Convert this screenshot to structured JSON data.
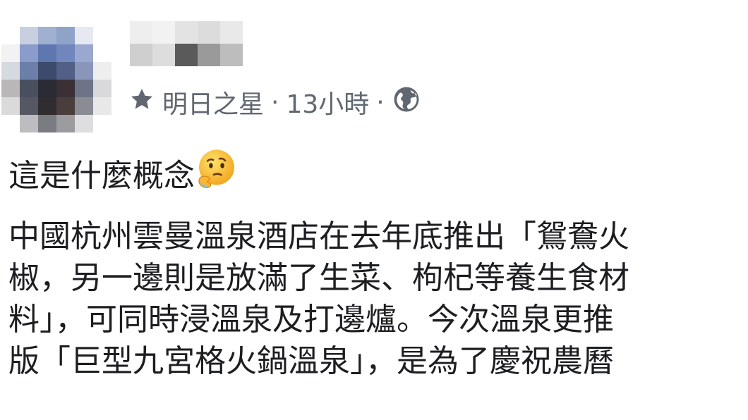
{
  "post": {
    "group_name": "明日之星",
    "timestamp": "13小時",
    "separator": "·",
    "privacy_icon": "globe-icon",
    "badge_icon": "star-icon",
    "short_text": "這是什麼概念",
    "emoji": "thinking-face-emoji",
    "body_lines": [
      "中國杭州雲曼溫泉酒店在去年底推出「鴛鴦火",
      "椒，另一邊則是放滿了生菜、枸杞等養生食材",
      "料」，可同時浸溫泉及打邊爐。今次溫泉更推",
      "版「巨型九宮格火鍋溫泉」，是為了慶祝農曆"
    ]
  },
  "colors": {
    "meta_text": "#606770",
    "body_text": "#1c1e21"
  }
}
